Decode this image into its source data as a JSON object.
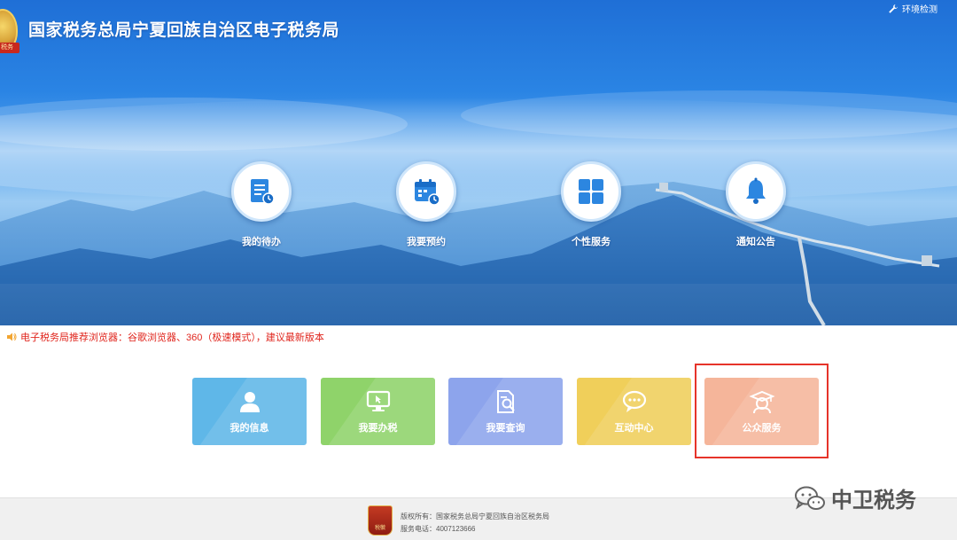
{
  "header": {
    "site_title": "国家税务总局宁夏回族自治区电子税务局",
    "env_check_label": "环境检测",
    "logo_text": "税务"
  },
  "quick_nav": [
    {
      "label": "我的待办",
      "icon": "todo-list-icon"
    },
    {
      "label": "我要预约",
      "icon": "calendar-icon"
    },
    {
      "label": "个性服务",
      "icon": "grid-icon"
    },
    {
      "label": "通知公告",
      "icon": "bell-icon"
    }
  ],
  "notice": {
    "text": "电子税务局推荐浏览器：谷歌浏览器、360（极速模式），建议最新版本",
    "color": "#e0261e"
  },
  "tiles": [
    {
      "label": "我的信息",
      "icon": "user-icon",
      "color": "#5fb7e8"
    },
    {
      "label": "我要办税",
      "icon": "monitor-icon",
      "color": "#8fd36a"
    },
    {
      "label": "我要查询",
      "icon": "document-search-icon",
      "color": "#8da4ec"
    },
    {
      "label": "互动中心",
      "icon": "chat-bubble-icon",
      "color": "#f0cf5a"
    },
    {
      "label": "公众服务",
      "icon": "graduate-icon",
      "color": "#f5b59a"
    }
  ],
  "highlight_color": "#e6342a",
  "footer": {
    "badge_text": "税徽",
    "copyright": "版权所有：国家税务总局宁夏回族自治区税务局",
    "phone": "服务电话：4007123666"
  },
  "watermark": {
    "text": "中卫税务",
    "icon": "wechat-icon"
  }
}
